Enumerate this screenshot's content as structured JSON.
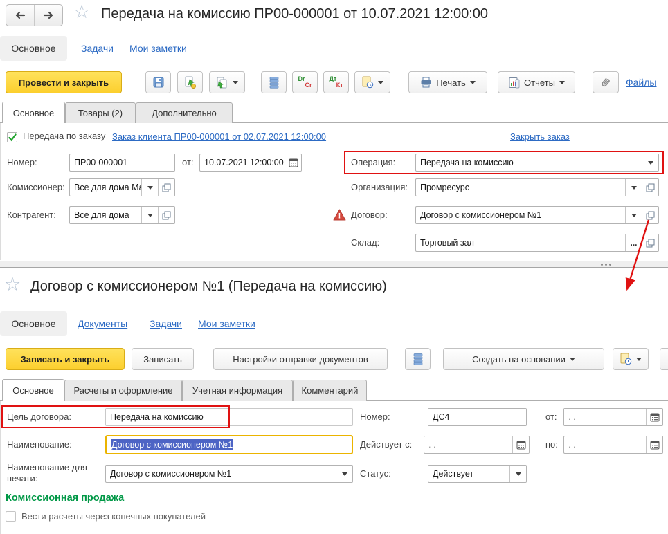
{
  "colors": {
    "accent_yellow": "#FFD24A",
    "annotation_red": "#E01212",
    "link_blue": "#2D6BC4",
    "selection_blue": "#4D64C5",
    "section_green": "#009846"
  },
  "icons": {
    "drcr_top": "Dr",
    "drcr_bottom": "Cr",
    "dtkt_top": "Дт",
    "dtkt_bottom": "Кт"
  },
  "win1": {
    "title": "Передача на комиссию ПР00-000001 от 10.07.2021 12:00:00",
    "nav": {
      "active": "Основное",
      "links": [
        "Задачи",
        "Мои заметки"
      ]
    },
    "toolbar": {
      "post_and_close": "Провести и закрыть",
      "print": "Печать",
      "reports": "Отчеты",
      "files": "Файлы"
    },
    "tabs": [
      "Основное",
      "Товары (2)",
      "Дополнительно"
    ],
    "order_row": {
      "checkbox": "Передача по заказу",
      "order_link": "Заказ клиента ПР00-000001 от 02.07.2021 12:00:00",
      "close_link": "Закрыть заказ"
    },
    "fields": {
      "number": {
        "label": "Номер:",
        "value": "ПР00-000001"
      },
      "date": {
        "label": "от:",
        "value": "10.07.2021 12:00:00"
      },
      "operation": {
        "label": "Операция:",
        "value": "Передача на комиссию"
      },
      "commissioner": {
        "label": "Комиссионер:",
        "value": "Все для дома Магазин"
      },
      "organization": {
        "label": "Организация:",
        "value": "Промресурс"
      },
      "counterparty": {
        "label": "Контрагент:",
        "value": "Все для дома"
      },
      "contract": {
        "label": "Договор:",
        "value": "Договор с комиссионером №1"
      },
      "warehouse": {
        "label": "Склад:",
        "value": "Торговый зал",
        "more": "..."
      }
    }
  },
  "win2": {
    "title": "Договор с комиссионером №1  (Передача на комиссию)",
    "nav": {
      "active": "Основное",
      "links": [
        "Документы",
        "Задачи",
        "Мои заметки"
      ]
    },
    "toolbar": {
      "save_and_close": "Записать и закрыть",
      "save": "Записать",
      "send_settings": "Настройки отправки документов",
      "create_based_on": "Создать на основании"
    },
    "tabs": [
      "Основное",
      "Расчеты и оформление",
      "Учетная информация",
      "Комментарий"
    ],
    "fields": {
      "purpose": {
        "label": "Цель договора:",
        "value": "Передача на комиссию"
      },
      "number": {
        "label": "Номер:",
        "value": "ДС4"
      },
      "date_from": {
        "label": "от:",
        "placeholder": " .  ."
      },
      "name": {
        "label": "Наименование:",
        "value": "Договор с комиссионером №1"
      },
      "valid_from": {
        "label": "Действует с:",
        "placeholder": " .  ."
      },
      "valid_to": {
        "label": "по:",
        "placeholder": " .  ."
      },
      "print_name": {
        "label": "Наименование для печати:",
        "value": "Договор с комиссионером №1"
      },
      "status": {
        "label": "Статус:",
        "value": "Действует"
      }
    },
    "section": {
      "heading": "Комиссионная продажа",
      "checkbox": "Вести расчеты через конечных покупателей"
    }
  }
}
